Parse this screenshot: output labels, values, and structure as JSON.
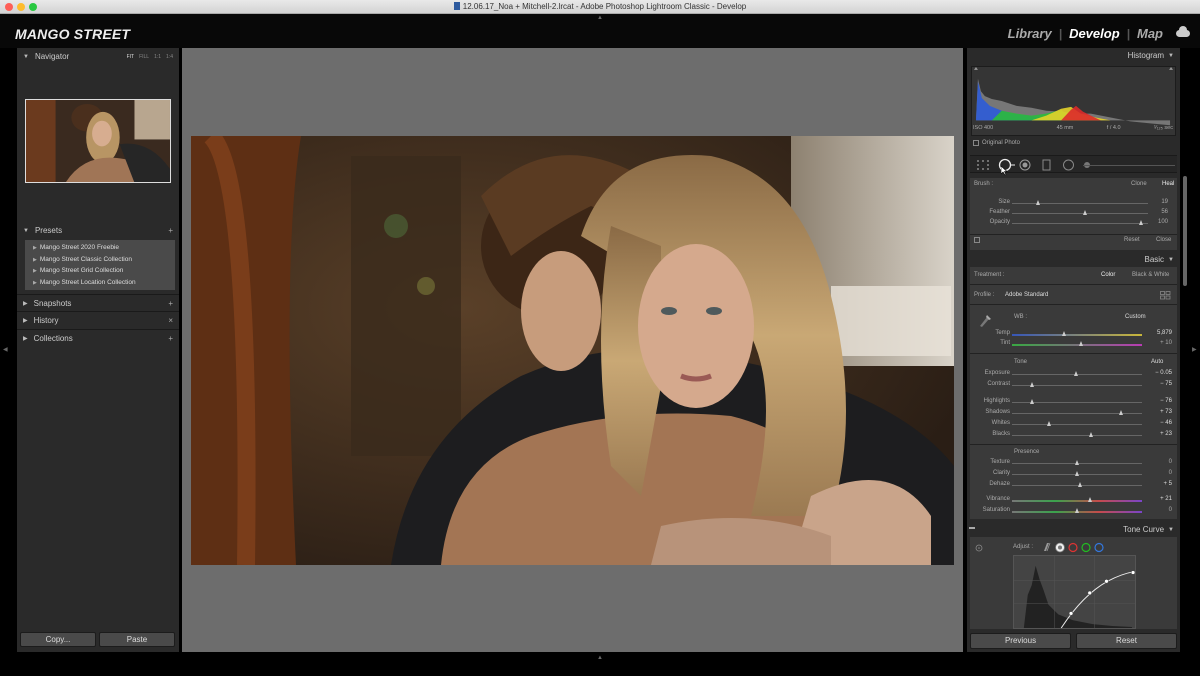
{
  "window": {
    "title": "12.06.17_Noa + Mitchell-2.lrcat - Adobe Photoshop Lightroom Classic - Develop"
  },
  "brand": {
    "logo": "MANGO STREET"
  },
  "modules": [
    "Library",
    "Develop",
    "Map"
  ],
  "active_module": "Develop",
  "left": {
    "navigator": {
      "label": "Navigator",
      "options": [
        "FIT",
        "FILL",
        "1:1",
        "1:4"
      ]
    },
    "presets": {
      "label": "Presets",
      "items": [
        "Mango Street 2020 Freebie",
        "Mango Street Classic Collection",
        "Mango Street Grid Collection",
        "Mango Street Location Collection"
      ]
    },
    "snapshots": "Snapshots",
    "history": "History",
    "collections": "Collections",
    "copy_button": "Copy...",
    "paste_button": "Paste"
  },
  "right": {
    "histogram": {
      "label": "Histogram",
      "iso": "ISO 400",
      "focal": "45 mm",
      "aperture": "f / 4.0",
      "shutter": "¹⁄₁₂₅ sec",
      "original_photo": "Original Photo"
    },
    "brush": {
      "label": "Brush :",
      "clone": "Clone",
      "heal": "Heal",
      "size_label": "Size",
      "size": "19",
      "feather_label": "Feather",
      "feather": "56",
      "opacity_label": "Opacity",
      "opacity": "100",
      "reset": "Reset",
      "close": "Close"
    },
    "basic": {
      "label": "Basic",
      "treatment_label": "Treatment :",
      "color": "Color",
      "bw": "Black & White",
      "profile_label": "Profile :",
      "profile": "Adobe Standard",
      "wb_label": "WB :",
      "wb": "Custom",
      "temp_label": "Temp",
      "temp": "5,879",
      "tint_label": "Tint",
      "tint": "+ 10",
      "tone_label": "Tone",
      "auto": "Auto",
      "exposure_label": "Exposure",
      "exposure": "− 0.05",
      "contrast_label": "Contrast",
      "contrast": "− 75",
      "highlights_label": "Highlights",
      "highlights": "− 76",
      "shadows_label": "Shadows",
      "shadows": "+ 73",
      "whites_label": "Whites",
      "whites": "− 46",
      "blacks_label": "Blacks",
      "blacks": "+ 23",
      "presence_label": "Presence",
      "texture_label": "Texture",
      "texture": "0",
      "clarity_label": "Clarity",
      "clarity": "0",
      "dehaze_label": "Dehaze",
      "dehaze": "+ 5",
      "vibrance_label": "Vibrance",
      "vibrance": "+ 21",
      "saturation_label": "Saturation",
      "saturation": "0"
    },
    "tone_curve": {
      "label": "Tone Curve",
      "adjust_label": "Adjust :"
    },
    "previous_button": "Previous",
    "reset_button": "Reset"
  }
}
